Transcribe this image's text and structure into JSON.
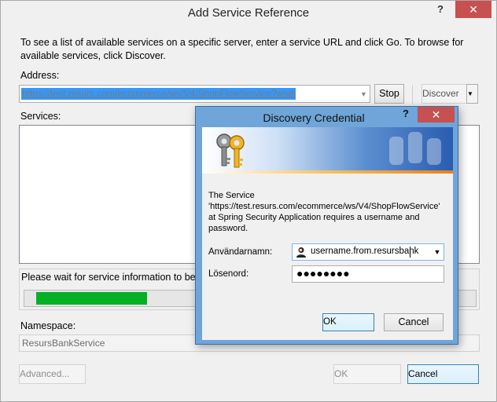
{
  "main_window": {
    "title": "Add Service Reference",
    "help_label": "?",
    "close_label": "✕",
    "description": "To see a list of available services on a specific server, enter a service URL and click Go. To browse for available services, click Discover.",
    "address_label": "Address:",
    "address_value": "https://test.resurs.com/ecommerce/ws/V4/ShopFlowService?wsdl",
    "stop_label": "Stop",
    "discover_label": "Discover",
    "services_label": "Services:",
    "wait_text": "Please wait for service information to be d",
    "progress_fraction": 0.26,
    "namespace_label": "Namespace:",
    "namespace_value": "ResursBankService",
    "advanced_label": "Advanced...",
    "ok_label": "OK",
    "cancel_label": "Cancel"
  },
  "credential_dialog": {
    "title": "Discovery Credential",
    "help_label": "?",
    "close_label": "✕",
    "message": "The Service 'https://test.resurs.com/ecommerce/ws/V4/ShopFlowService' at Spring Security Application requires a username and password.",
    "username_label": "Användarnamn:",
    "username_value": "username.from.resursbank",
    "password_label": "Lösenord:",
    "password_value": "●●●●●●●●",
    "ok_label": "OK",
    "cancel_label": "Cancel"
  },
  "icons": {
    "banner": "keys-icon",
    "user": "user-icon",
    "dropdown": "chevron-down-icon"
  },
  "colors": {
    "progress_fill": "#06b025",
    "close_button": "#c75050",
    "dialog_frame": "#6fa5d8",
    "selection": "#3399ff"
  }
}
